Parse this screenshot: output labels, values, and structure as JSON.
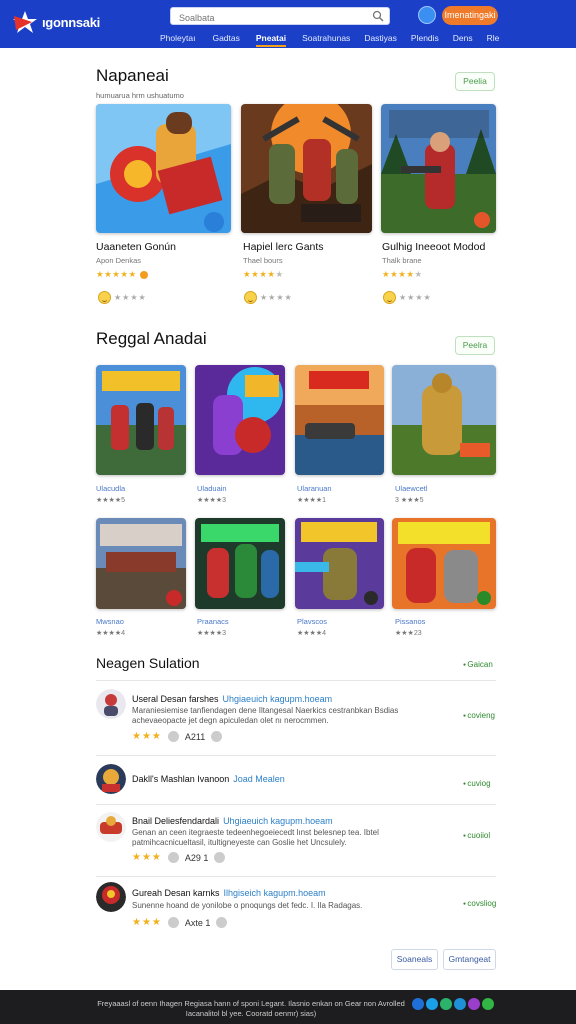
{
  "header": {
    "logo_text": "ıgonnsaki",
    "search_placeholder": "Soalbata",
    "cta_label": "Imenatingaki",
    "nav": [
      "Pholeytaı",
      "Gadtas",
      "Pneatai",
      "Soatrahunas",
      "Dastiyas",
      "Plendis",
      "Dens",
      "Rle"
    ],
    "colors": {
      "bar": "#1b3fc6",
      "cta": "#ef7a2a",
      "active_underline": "#f4a11a"
    }
  },
  "featured": {
    "title": "Napaneai",
    "subtitle": "humuarua hrm ushuatumo",
    "more_label": "Peelia",
    "cards": [
      {
        "title": "Uaaneten Gonún",
        "sub": "Apon Denkas",
        "stars_on": 5,
        "stars_total": 5
      },
      {
        "title": "Hapiel lerc Gants",
        "sub": "Thael bours",
        "stars_on": 4,
        "stars_total": 5
      },
      {
        "title": "Gulhig Ineeoot Modod",
        "sub": "Thalk brane",
        "stars_on": 4,
        "stars_total": 5
      }
    ]
  },
  "regional": {
    "title": "Reggal Anadai",
    "more_label": "Peelra",
    "tiles": [
      {
        "label": "Ulacudla",
        "sub": "★★★★5"
      },
      {
        "label": "Uladuain",
        "sub": "★★★★3"
      },
      {
        "label": "Ularanuan",
        "sub": "★★★★1"
      },
      {
        "label": "Ulaewcetl",
        "sub": "3 ★★★5"
      },
      {
        "label": "Mwsnao",
        "sub": "★★★★4"
      },
      {
        "label": "Praanacs",
        "sub": "★★★★3"
      },
      {
        "label": "Plavscos",
        "sub": "★★★★4"
      },
      {
        "label": "Pissanos",
        "sub": "★★★23"
      }
    ]
  },
  "reviews": {
    "title": "Neagen Sulation",
    "top_link": "Gaican",
    "items": [
      {
        "title": "Useral Desan farshes",
        "highlight": "Uhgiaeuich kagupm.hoeam",
        "body": "Maraniesiemise tanfiendagen dene Iltangesal Naerkics cestranbkan Bsdias achevaeopacte jet degn apiculedan olet nı nerocmmen.",
        "score": "A211",
        "link": "covieng"
      },
      {
        "title": "Dakll's Mashlan Ivanoon",
        "highlight": "Joad Mealen",
        "body": "",
        "score": "",
        "link": "cuviog"
      },
      {
        "title": "Bnail Deliesfendardali",
        "highlight": "Uhgiaeuich kagupm.hoeam",
        "body": "Genan an ceen itegraeste tedeenhegoeiecedt lınst belesnep tea. Ibtel patmihcacnicueltasil, itultigneyeste can Goslie het Uncsulely.",
        "score": "A29 1",
        "link": "cuoiiol"
      },
      {
        "title": "Gureah Desan karnks",
        "highlight": "Ilhgiseich kagupm.hoeam",
        "body": "Sunenne hoand de yonilobe o pnoqungs det fedc. I. Ila Radagas.",
        "score": "Axte 1",
        "link": "covsliog"
      }
    ]
  },
  "pagination": {
    "prev": "Soaneals",
    "next": "Gmtangeat"
  },
  "footer": {
    "text": "Freyaaasl of oenn Ihagen Regiasa hann of sponi Legant. Ilasnio enkan on Gear non Avrolled Iacanalitol bl yee. Cooratd oenmr) sias)",
    "social_colors": [
      "#1f6fd8",
      "#19a0e8",
      "#2bb36b",
      "#1f8fd8",
      "#9b3ecb",
      "#31b545"
    ]
  }
}
